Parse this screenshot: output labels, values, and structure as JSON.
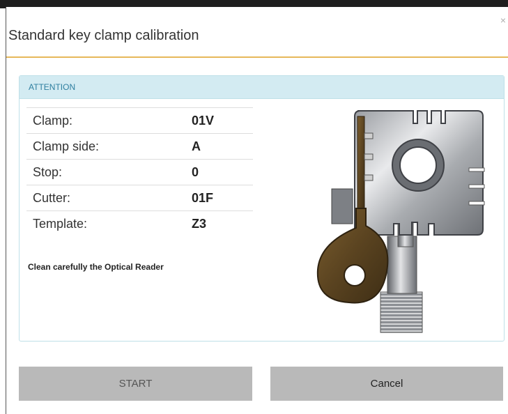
{
  "dialog": {
    "title": "Standard key clamp calibration",
    "close_label": "×"
  },
  "panel": {
    "header": "ATTENTION",
    "rows": [
      {
        "label": "Clamp:",
        "value": "01V"
      },
      {
        "label": "Clamp side:",
        "value": "A"
      },
      {
        "label": "Stop:",
        "value": "0"
      },
      {
        "label": "Cutter:",
        "value": "01F"
      },
      {
        "label": "Template:",
        "value": "Z3"
      }
    ],
    "note": "Clean carefully the Optical Reader"
  },
  "buttons": {
    "start_label": "START",
    "cancel_label": "Cancel"
  },
  "colors": {
    "header_rule": "#e6b85a",
    "attention_bg": "#d3ebf2",
    "attention_text": "#2f7fa0",
    "button_bg": "#b9b9b9"
  },
  "icons": [
    "close-icon",
    "key-clamp-illustration"
  ]
}
